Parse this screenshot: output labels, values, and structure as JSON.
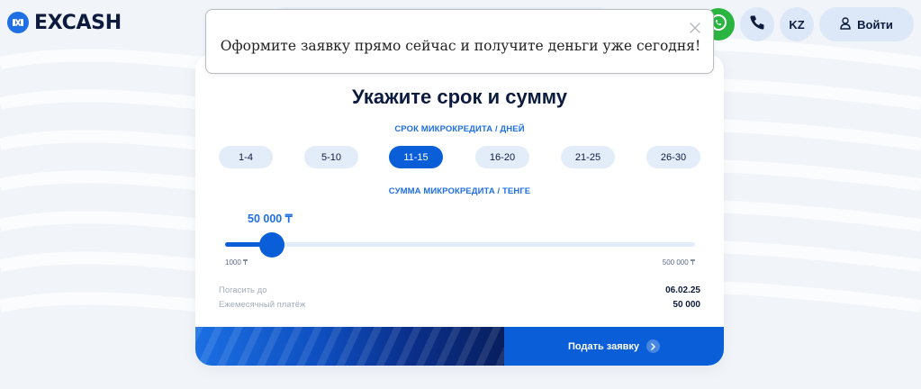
{
  "header": {
    "brand": "EXCASH",
    "lang": "KZ",
    "login_label": "Войти"
  },
  "popup": {
    "message": "Оформите заявку прямо сейчас и получите деньги уже сегодня!"
  },
  "form": {
    "title": "Укажите срок и сумму",
    "term_label": "СРОК МИКРОКРЕДИТА / ДНЕЙ",
    "terms": [
      "1-4",
      "5-10",
      "11-15",
      "16-20",
      "21-25",
      "26-30"
    ],
    "selected_term": "11-15",
    "amount_label": "СУММА МИКРОКРЕДИТА / ТЕНГЕ",
    "amount_value": "50 000 ₸",
    "amount": 50000,
    "slider_min_label": "1000 ₸",
    "slider_max_label": "500 000 ₸",
    "slider_min": 1000,
    "slider_max": 500000,
    "repay_label": "Погасить до",
    "repay_value": "06.02.25",
    "monthly_label": "Ежемесячный платёж",
    "monthly_value": "50 000",
    "submit_label": "Подать заявку"
  },
  "colors": {
    "accent": "#0a5fd9",
    "accent_text": "#1f6fe5",
    "whatsapp": "#2ab540",
    "dark_text": "#0d1b3e"
  },
  "icons": {
    "brand": "excash-logo-icon",
    "whatsapp": "whatsapp-icon",
    "phone": "phone-icon",
    "user": "user-icon",
    "close": "close-icon",
    "arrow": "chevron-right-icon"
  }
}
